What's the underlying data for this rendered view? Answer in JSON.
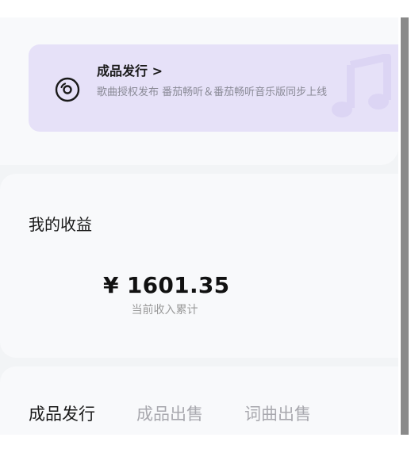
{
  "release_card": {
    "title": "成品发行 >",
    "description": "歌曲授权发布 番茄畅听＆番茄畅听音乐版同步上线",
    "icon": "disc-icon",
    "watermark_icon": "music-note-icon"
  },
  "earnings": {
    "title": "我的收益",
    "amount": "¥ 1601.35",
    "caption": "当前收入累计"
  },
  "tabs": [
    {
      "label": "成品发行",
      "active": true
    },
    {
      "label": "成品出售",
      "active": false
    },
    {
      "label": "词曲出售",
      "active": false
    }
  ],
  "colors": {
    "banner_bg": "#e6e1f8",
    "card_bg": "#f8f9fb",
    "page_bg": "#f2f4f6",
    "scroll_thumb": "#8a8a8a"
  }
}
